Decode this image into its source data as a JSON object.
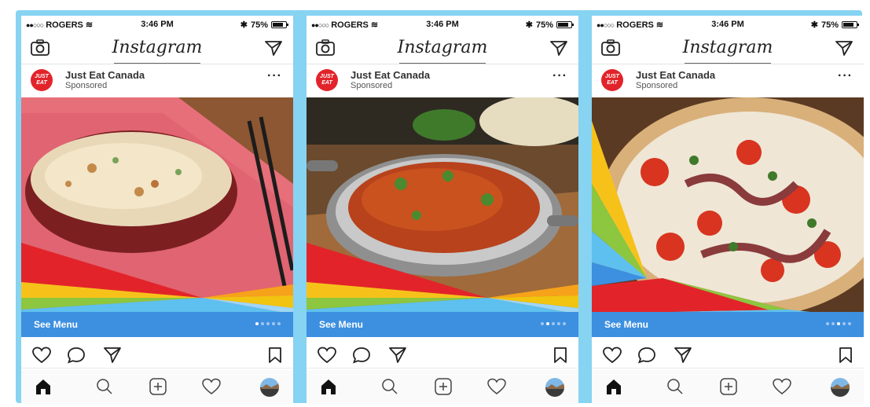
{
  "status_bar": {
    "carrier": "ROGERS",
    "time": "3:46 PM",
    "battery": "75%"
  },
  "app": {
    "logo_text": "Instagram"
  },
  "post": {
    "brand_name": "Just Eat Canada",
    "sponsored_label": "Sponsored",
    "brand_logo_text": "JUST EAT",
    "more_label": "···",
    "cta_label": "See Menu"
  },
  "slides": [
    {
      "subject": "fried-rice-bowl",
      "active_dot": 0
    },
    {
      "subject": "curry-dish",
      "active_dot": 1
    },
    {
      "subject": "pizza",
      "active_dot": 2
    }
  ],
  "colors": {
    "frame_bg": "#86d3f2",
    "cta_bg": "#3d8fe0",
    "brand_red": "#e2242a"
  },
  "icons": [
    "camera-icon",
    "send-icon",
    "heart-icon",
    "comment-icon",
    "share-icon",
    "bookmark-icon",
    "home-icon",
    "search-icon",
    "add-icon",
    "activity-heart-icon",
    "profile-avatar"
  ]
}
